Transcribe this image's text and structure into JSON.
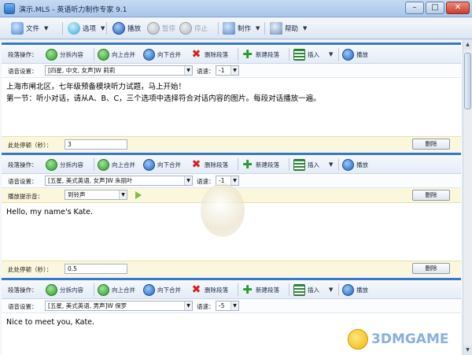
{
  "window": {
    "title": "演示.MLS - 英语听力制作专家 9.1",
    "controls": {
      "minimize": "–",
      "maximize": "□",
      "close": "✕"
    }
  },
  "menubar": {
    "file": "文件",
    "options": "选项",
    "play": "播放",
    "pause": "暂停",
    "stop": "停止",
    "make": "制作",
    "help": "帮助"
  },
  "labels": {
    "para_ops": "段落操作：",
    "split": "分拆内容",
    "merge_up": "向上合并",
    "merge_down": "向下合并",
    "delete_para": "删除段落",
    "new_para": "新建段落",
    "insert": "插入",
    "play": "播放",
    "voice_settings": "语音设置：",
    "speed": "语速：",
    "pause_label": "此处停顿（秒）：",
    "delete": "删除",
    "hint_label": "播放提示音："
  },
  "blocks": [
    {
      "voice": "[四星, 中文, 女声]W 莉莉",
      "speed": "-1",
      "text_lines": [
        "上海市闸北区，七年级预备模块听力试题，马上开始！",
        "第一节：听小对话，请从A、B、C，三个选项中选择符合对话内容的图片。每段对话播放一遍。"
      ],
      "pause": "3"
    },
    {
      "voice": "[五星, 美式英语, 女声]W 朱丽叶",
      "speed": "-1",
      "hint": "到铃声",
      "text_lines": [
        "Hello, my name's Kate."
      ],
      "pause": "0.5"
    },
    {
      "voice": "[五星, 美式英语, 男声]W 保罗",
      "speed": "-5",
      "text_lines": [
        "Nice to meet you, Kate."
      ]
    }
  ],
  "watermark": "3DMGAME",
  "colors": {
    "accent": "#3a78c2",
    "hint_bg": "#fbf7dc"
  }
}
